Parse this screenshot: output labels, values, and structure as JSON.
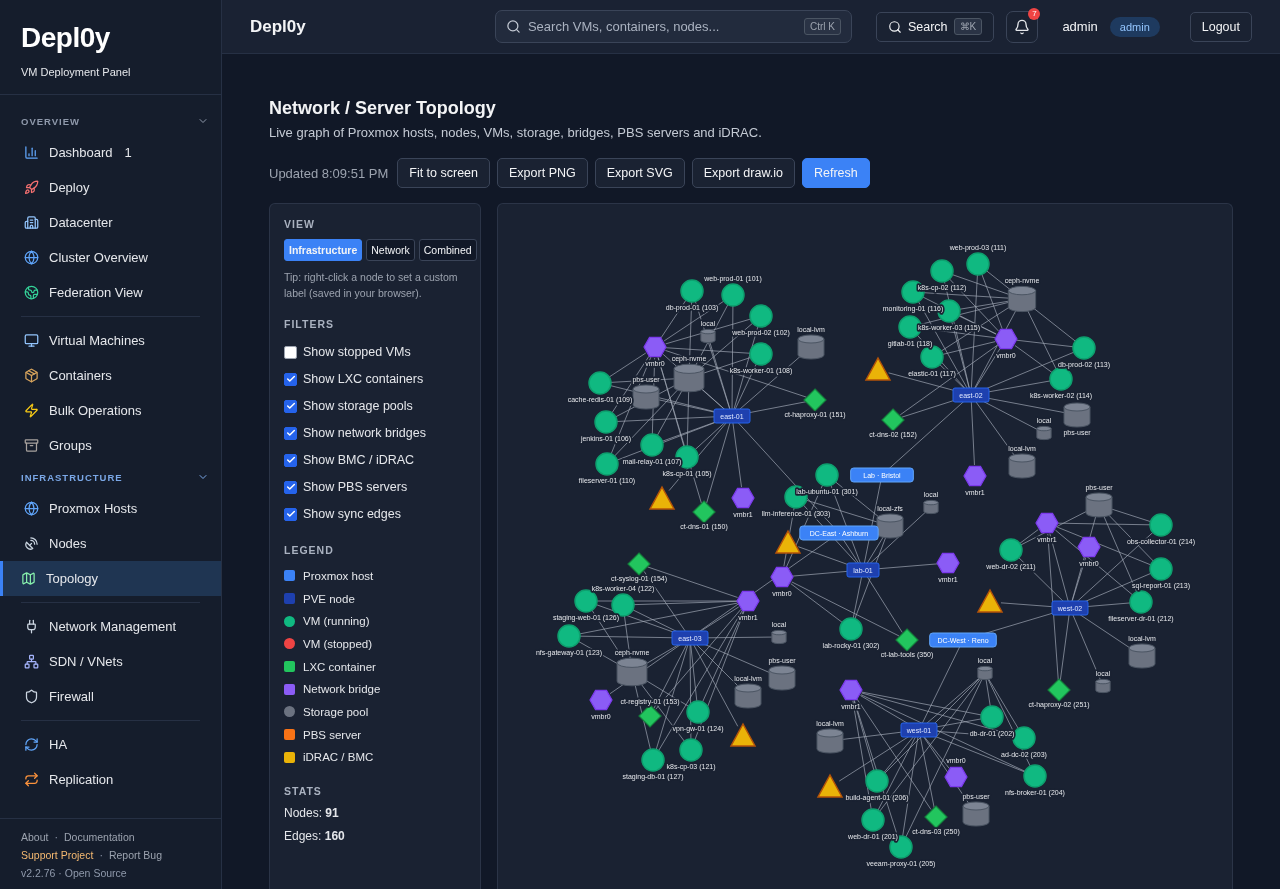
{
  "brand": {
    "logo": "Depl**0**y",
    "tagline": "VM Deployment Panel"
  },
  "sidebar": {
    "sections": [
      {
        "title": "OVERVIEW",
        "groups": [
          [
            {
              "label": "Dashboard",
              "badge": "1",
              "selected": false
            },
            {
              "label": "Deploy",
              "selected": false
            },
            {
              "label": "Datacenter",
              "selected": false
            },
            {
              "label": "Cluster Overview",
              "selected": false
            },
            {
              "label": "Federation View",
              "selected": false
            }
          ],
          [
            {
              "label": "Virtual Machines",
              "selected": false
            },
            {
              "label": "Containers",
              "selected": false
            },
            {
              "label": "Bulk Operations",
              "selected": false
            },
            {
              "label": "Groups",
              "selected": false
            }
          ]
        ]
      },
      {
        "title": "INFRASTRUCTURE",
        "groups": [
          [
            {
              "label": "Proxmox Hosts",
              "selected": false
            },
            {
              "label": "Nodes",
              "selected": false
            },
            {
              "label": "Topology",
              "selected": true
            }
          ],
          [
            {
              "label": "Network Management",
              "selected": false
            },
            {
              "label": "SDN / VNets",
              "selected": false
            },
            {
              "label": "Firewall",
              "selected": false
            }
          ],
          [
            {
              "label": "HA",
              "selected": false
            },
            {
              "label": "Replication",
              "selected": false
            }
          ]
        ]
      }
    ],
    "footer": [
      [
        {
          "kind": "link",
          "label": "About"
        },
        {
          "kind": "sep",
          "label": "·"
        },
        {
          "kind": "link",
          "label": "Documentation"
        }
      ],
      [
        {
          "kind": "accent",
          "label": "Support Project"
        },
        {
          "kind": "sep",
          "label": "·"
        },
        {
          "kind": "link",
          "label": "Report Bug"
        }
      ],
      [
        {
          "kind": "text",
          "label": "v2.2.76 · Open Source"
        }
      ]
    ]
  },
  "header": {
    "title": "Depl0y",
    "search": {
      "placeholder": "Search VMs, containers, nodes...",
      "shortcut": "Ctrl K"
    },
    "search_button": {
      "label": "Search",
      "shortcut": "⌘K"
    },
    "notifications": "7",
    "user": "admin",
    "role": "admin",
    "logout": "Logout"
  },
  "page": {
    "title": "Network / Server Topology",
    "subtitle": "Live graph of Proxmox hosts, nodes, VMs, storage, bridges, PBS servers and iDRAC.",
    "updated": "Updated 8:09:51 PM",
    "actions": [
      {
        "label": "Fit to screen",
        "primary": false
      },
      {
        "label": "Export PNG",
        "primary": false
      },
      {
        "label": "Export SVG",
        "primary": false
      },
      {
        "label": "Export draw.io",
        "primary": false
      },
      {
        "label": "Refresh",
        "primary": true
      }
    ]
  },
  "panel": {
    "view_title": "VIEW",
    "views": [
      {
        "label": "Infrastructure",
        "selected": true
      },
      {
        "label": "Network",
        "selected": false
      },
      {
        "label": "Combined",
        "selected": false
      }
    ],
    "tip": "Tip: right-click a node to set a custom label (saved in your browser).",
    "filters_title": "FILTERS",
    "filters": [
      {
        "label": "Show stopped VMs",
        "checked": false
      },
      {
        "label": "Show LXC containers",
        "checked": true
      },
      {
        "label": "Show storage pools",
        "checked": true
      },
      {
        "label": "Show network bridges",
        "checked": true
      },
      {
        "label": "Show BMC / iDRAC",
        "checked": true
      },
      {
        "label": "Show PBS servers",
        "checked": true
      },
      {
        "label": "Show sync edges",
        "checked": true
      }
    ],
    "legend_title": "LEGEND",
    "legend": [
      {
        "label": "Proxmox host",
        "color": "#3b82f6",
        "kind": "square"
      },
      {
        "label": "PVE node",
        "color": "#1e40af",
        "kind": "square"
      },
      {
        "label": "VM (running)",
        "color": "#10b981",
        "kind": "dot"
      },
      {
        "label": "VM (stopped)",
        "color": "#ef4444",
        "kind": "dot"
      },
      {
        "label": "LXC container",
        "color": "#22c55e",
        "kind": "square"
      },
      {
        "label": "Network bridge",
        "color": "#8b5cf6",
        "kind": "square"
      },
      {
        "label": "Storage pool",
        "color": "#6b7280",
        "kind": "dot"
      },
      {
        "label": "PBS server",
        "color": "#f97316",
        "kind": "square"
      },
      {
        "label": "iDRAC / BMC",
        "color": "#eab308",
        "kind": "square"
      }
    ],
    "stats_title": "STATS",
    "stats": [
      "Nodes: **91**",
      "Edges: **160**"
    ]
  },
  "topology": {
    "sites": [
      {
        "label": "DC-East · Ashburn"
      },
      {
        "label": "Lab · Bristol"
      },
      {
        "label": "DC-West · Reno"
      }
    ],
    "clusters": [
      {
        "hub": "east-01",
        "members": [
          {
            "kind": "vm",
            "label": "db-prod-01 (103)"
          },
          {
            "kind": "vm",
            "label": "web-prod-01 (101)"
          },
          {
            "kind": "vm",
            "label": "web-prod-02 (102)"
          },
          {
            "kind": "vm",
            "label": "k8s-worker-01 (108)"
          },
          {
            "kind": "bridge",
            "label": "vmbr0"
          },
          {
            "kind": "storage",
            "label": "local"
          },
          {
            "kind": "storage",
            "label": "ceph-nvme"
          },
          {
            "kind": "storage",
            "label": "pbs-user"
          },
          {
            "kind": "storage",
            "label": "local-lvm"
          },
          {
            "kind": "vm",
            "label": "cache-redis-01 (109)"
          },
          {
            "kind": "vm",
            "label": "jenkins-01 (106)"
          },
          {
            "kind": "vm",
            "label": "mail-relay-01 (107)"
          },
          {
            "kind": "vm",
            "label": "fileserver-01 (110)"
          },
          {
            "kind": "vm",
            "label": "k8s-cp-01 (105)"
          },
          {
            "kind": "lxc",
            "label": "ct-haproxy-01 (151)"
          },
          {
            "kind": "bmc"
          },
          {
            "kind": "lxc",
            "label": "ct-dns-01 (150)"
          },
          {
            "kind": "bridge",
            "label": "vmbr1"
          }
        ]
      },
      {
        "hub": "east-02",
        "members": [
          {
            "kind": "vm",
            "label": "web-prod-03 (111)"
          },
          {
            "kind": "vm",
            "label": "k8s-cp-02 (112)"
          },
          {
            "kind": "vm",
            "label": "monitoring-01 (116)"
          },
          {
            "kind": "vm",
            "label": "k8s-worker-03 (115)"
          },
          {
            "kind": "vm",
            "label": "gitlab-01 (118)"
          },
          {
            "kind": "vm",
            "label": "elastic-01 (117)"
          },
          {
            "kind": "storage",
            "label": "ceph-nvme"
          },
          {
            "kind": "bridge",
            "label": "vmbr0"
          },
          {
            "kind": "vm",
            "label": "db-prod-02 (113)"
          },
          {
            "kind": "vm",
            "label": "k8s-worker-02 (114)"
          },
          {
            "kind": "storage",
            "label": "pbs-user"
          },
          {
            "kind": "storage",
            "label": "local"
          },
          {
            "kind": "storage",
            "label": "local-lvm"
          },
          {
            "kind": "bridge",
            "label": "vmbr1"
          },
          {
            "kind": "bmc"
          },
          {
            "kind": "lxc",
            "label": "ct-dns-02 (152)"
          }
        ]
      },
      {
        "hub": "lab-01",
        "members": [
          {
            "kind": "vm",
            "label": "lab-ubuntu-01 (301)"
          },
          {
            "kind": "vm",
            "label": "llm-inference-01 (303)"
          },
          {
            "kind": "bmc"
          },
          {
            "kind": "bridge",
            "label": "vmbr0"
          },
          {
            "kind": "storage",
            "label": "local-zfs"
          },
          {
            "kind": "storage",
            "label": "local"
          },
          {
            "kind": "bridge",
            "label": "vmbr1"
          },
          {
            "kind": "vm",
            "label": "lab-rocky-01 (302)"
          },
          {
            "kind": "lxc",
            "label": "ct-lab-tools (350)"
          }
        ]
      },
      {
        "hub": "east-03",
        "members": [
          {
            "kind": "lxc",
            "label": "ct-syslog-01 (154)"
          },
          {
            "kind": "vm",
            "label": "staging-web-01 (126)"
          },
          {
            "kind": "vm",
            "label": "k8s-worker-04 (122)"
          },
          {
            "kind": "vm",
            "label": "nfs-gateway-01 (123)"
          },
          {
            "kind": "bridge",
            "label": "vmbr1"
          },
          {
            "kind": "storage",
            "label": "local"
          },
          {
            "kind": "storage",
            "label": "ceph-nvme"
          },
          {
            "kind": "storage",
            "label": "pbs-user"
          },
          {
            "kind": "storage",
            "label": "local-lvm"
          },
          {
            "kind": "bridge",
            "label": "vmbr0"
          },
          {
            "kind": "lxc",
            "label": "ct-registry-01 (153)"
          },
          {
            "kind": "vm",
            "label": "vpn-gw-01 (124)"
          },
          {
            "kind": "vm",
            "label": "k8s-cp-03 (121)"
          },
          {
            "kind": "vm",
            "label": "staging-db-01 (127)"
          },
          {
            "kind": "bmc"
          }
        ]
      },
      {
        "hub": "west-02",
        "members": [
          {
            "kind": "storage",
            "label": "pbs-user"
          },
          {
            "kind": "bridge",
            "label": "vmbr1"
          },
          {
            "kind": "vm",
            "label": "obs-collector-01 (214)"
          },
          {
            "kind": "bridge",
            "label": "vmbr0"
          },
          {
            "kind": "vm",
            "label": "web-dr-02 (211)"
          },
          {
            "kind": "vm",
            "label": "sql-report-01 (213)"
          },
          {
            "kind": "vm",
            "label": "fileserver-dr-01 (212)"
          },
          {
            "kind": "bmc"
          },
          {
            "kind": "storage",
            "label": "local-lvm"
          },
          {
            "kind": "storage",
            "label": "local"
          },
          {
            "kind": "lxc",
            "label": "ct-haproxy-02 (251)"
          }
        ]
      },
      {
        "hub": "west-01",
        "members": [
          {
            "kind": "bridge",
            "label": "vmbr1"
          },
          {
            "kind": "storage",
            "label": "local"
          },
          {
            "kind": "vm",
            "label": "db-dr-01 (202)"
          },
          {
            "kind": "vm",
            "label": "ad-dc-02 (203)"
          },
          {
            "kind": "vm",
            "label": "nfs-broker-01 (204)"
          },
          {
            "kind": "storage",
            "label": "local-lvm"
          },
          {
            "kind": "bmc"
          },
          {
            "kind": "vm",
            "label": "build-agent-01 (206)"
          },
          {
            "kind": "bridge",
            "label": "vmbr0"
          },
          {
            "kind": "vm",
            "label": "web-dr-01 (201)"
          },
          {
            "kind": "lxc",
            "label": "ct-dns-03 (250)"
          },
          {
            "kind": "storage",
            "label": "pbs-user"
          },
          {
            "kind": "vm",
            "label": "veeam-proxy-01 (205)"
          }
        ]
      }
    ]
  }
}
